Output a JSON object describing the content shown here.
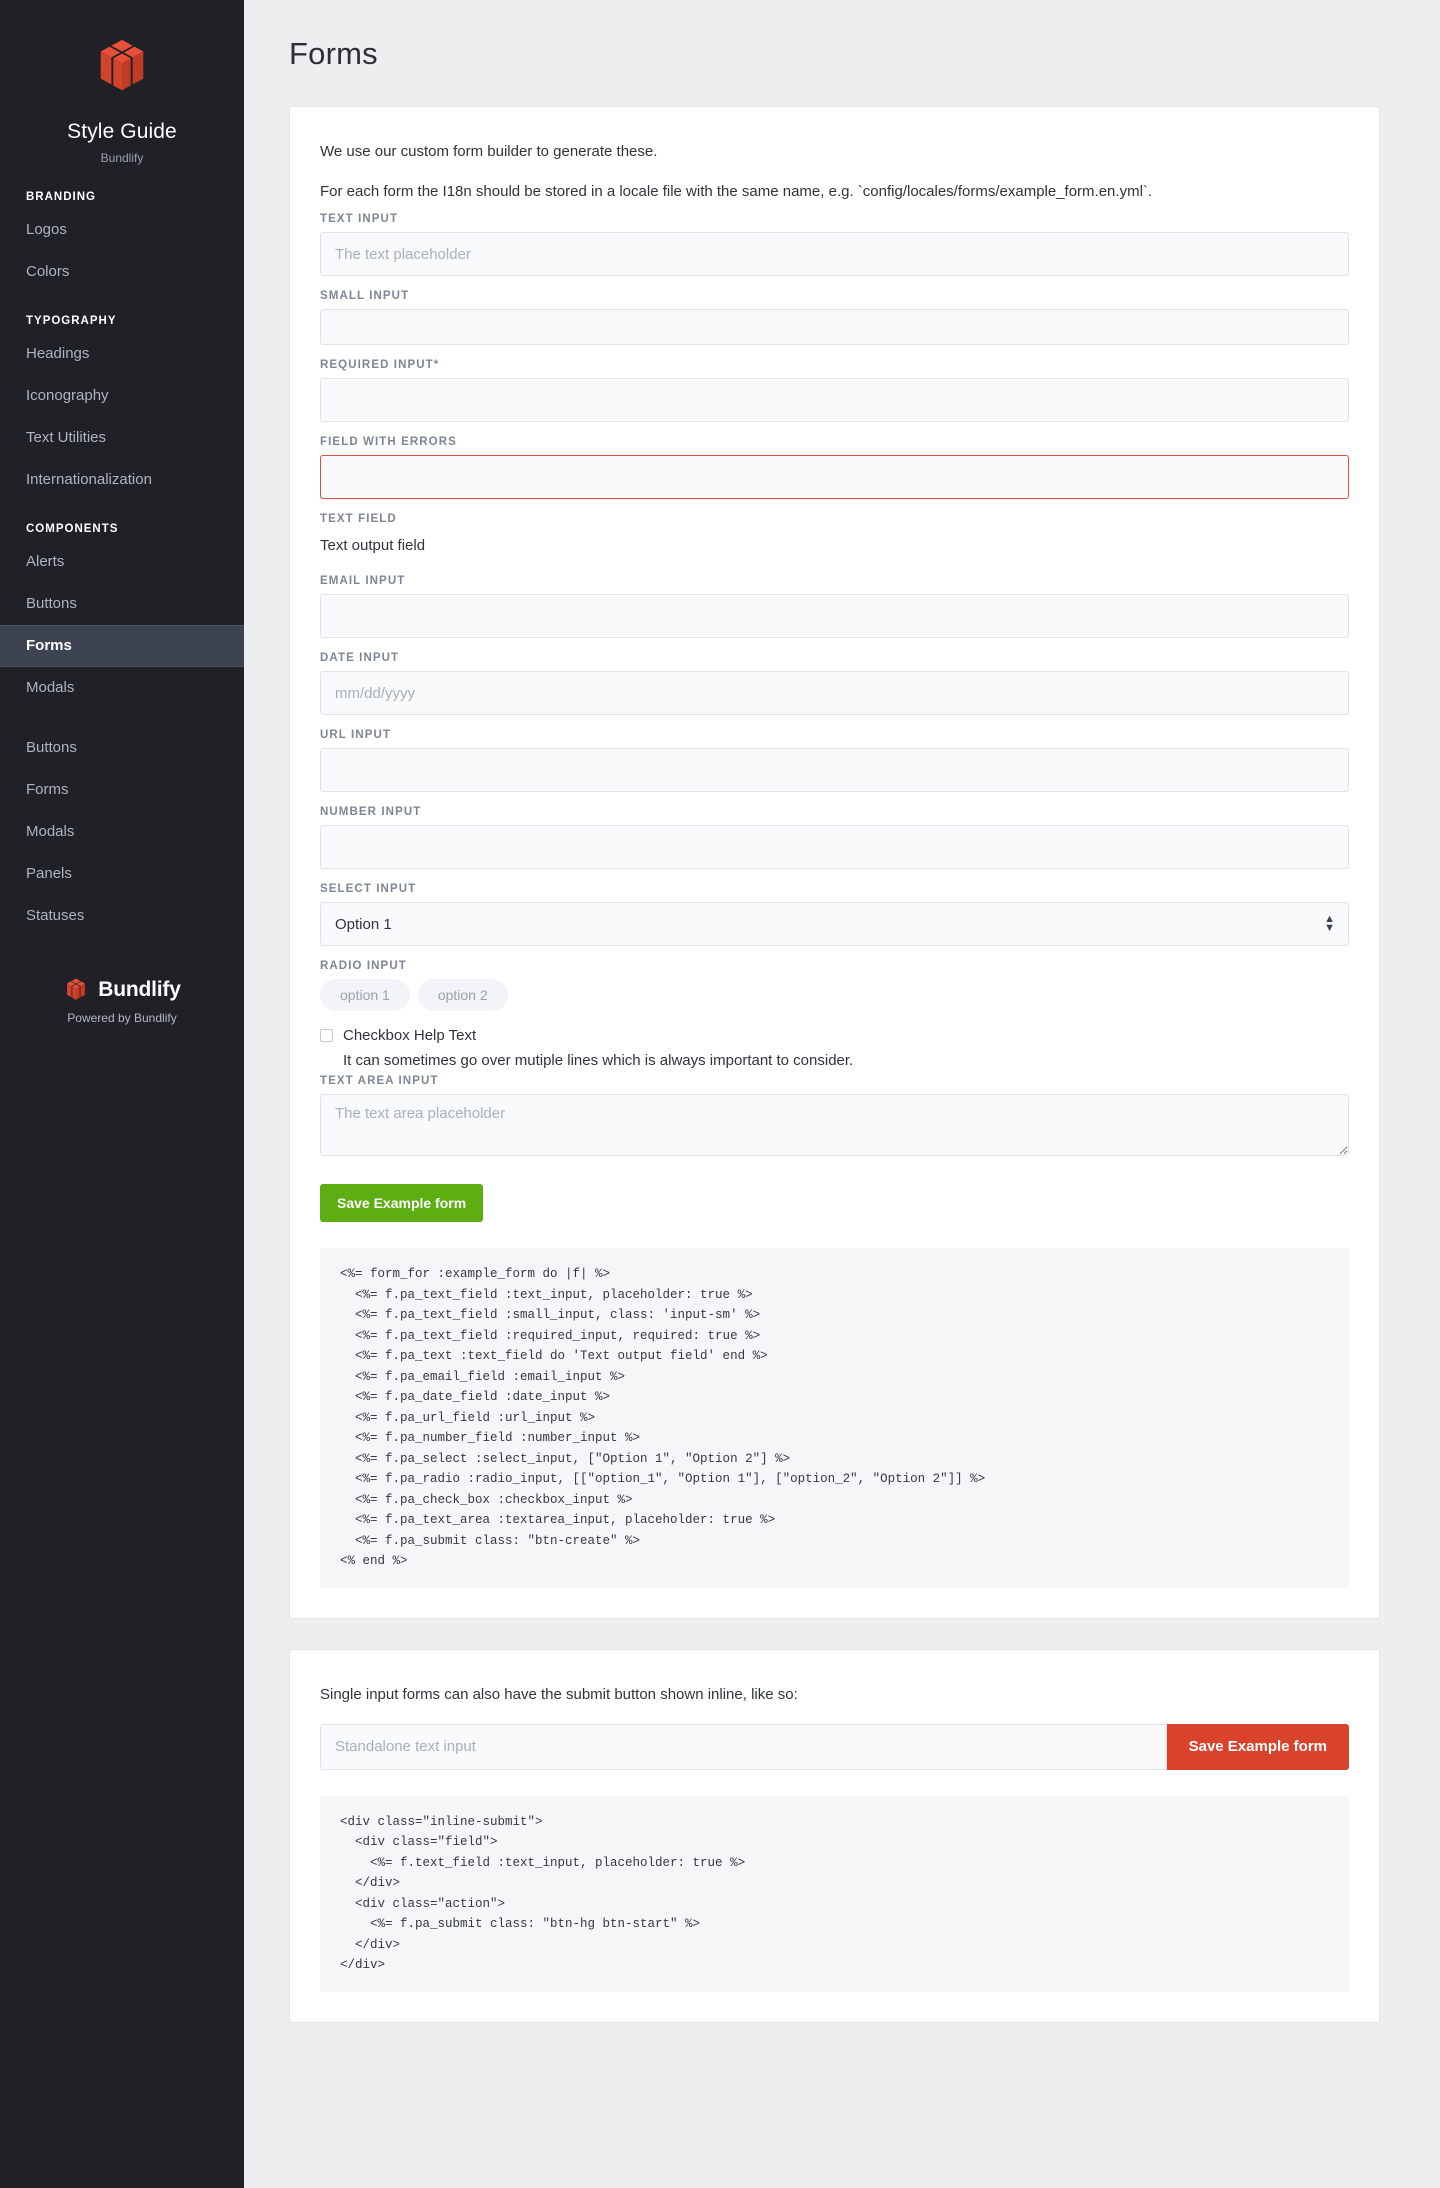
{
  "sidebar": {
    "brand": {
      "logo_icon": "cube-logo-icon",
      "title": "Style Guide",
      "subtitle": "Bundlify"
    },
    "groups": [
      {
        "section": "BRANDING",
        "items": [
          {
            "label": "Logos",
            "active": false
          },
          {
            "label": "Colors",
            "active": false
          }
        ]
      },
      {
        "section": "TYPOGRAPHY",
        "items": [
          {
            "label": "Headings",
            "active": false
          },
          {
            "label": "Iconography",
            "active": false
          },
          {
            "label": "Text Utilities",
            "active": false
          },
          {
            "label": "Internationalization",
            "active": false
          }
        ]
      },
      {
        "section": "COMPONENTS",
        "items": [
          {
            "label": "Alerts",
            "active": false
          },
          {
            "label": "Buttons",
            "active": false
          },
          {
            "label": "Forms",
            "active": true
          },
          {
            "label": "Modals",
            "active": false
          }
        ]
      },
      {
        "section": "",
        "items": [
          {
            "label": "Buttons",
            "active": false
          },
          {
            "label": "Forms",
            "active": false
          },
          {
            "label": "Modals",
            "active": false
          },
          {
            "label": "Panels",
            "active": false
          },
          {
            "label": "Statuses",
            "active": false
          }
        ]
      }
    ],
    "footer": {
      "logo_icon": "cube-logo-icon",
      "name": "Bundlify",
      "powered_by": "Powered by Bundlify"
    }
  },
  "page": {
    "title": "Forms"
  },
  "card1": {
    "lead1": "We use our custom form builder to generate these.",
    "lead2": "For each form the I18n should be stored in a locale file with the same name, e.g. `config/locales/forms/example_form.en.yml`.",
    "fields": {
      "text_input": {
        "label": "TEXT INPUT",
        "placeholder": "The text placeholder",
        "value": ""
      },
      "small_input": {
        "label": "SMALL INPUT",
        "placeholder": "",
        "value": ""
      },
      "required_input": {
        "label": "REQUIRED INPUT*",
        "placeholder": "",
        "value": ""
      },
      "field_with_errors": {
        "label": "FIELD WITH ERRORS",
        "placeholder": "",
        "value": ""
      },
      "text_field": {
        "label": "TEXT FIELD",
        "value": "Text output field"
      },
      "email_input": {
        "label": "EMAIL INPUT",
        "placeholder": "",
        "value": ""
      },
      "date_input": {
        "label": "DATE INPUT",
        "placeholder": "mm/dd/yyyy",
        "value": ""
      },
      "url_input": {
        "label": "URL INPUT",
        "placeholder": "",
        "value": ""
      },
      "number_input": {
        "label": "NUMBER INPUT",
        "placeholder": "",
        "value": ""
      },
      "select_input": {
        "label": "SELECT INPUT",
        "selected": "Option 1",
        "options": [
          "Option 1",
          "Option 2"
        ],
        "arrow_icon": "select-stepper-icon"
      },
      "radio_input": {
        "label": "RADIO INPUT",
        "options": [
          "option 1",
          "option 2"
        ]
      },
      "checkbox_input": {
        "label": "Checkbox Help Text",
        "help": "It can sometimes go over mutiple lines which is always important to consider.",
        "checked": false
      },
      "textarea_input": {
        "label": "TEXT AREA INPUT",
        "placeholder": "The text area placeholder",
        "value": ""
      }
    },
    "submit_label": "Save Example form",
    "code": "<%= form_for :example_form do |f| %>\n  <%= f.pa_text_field :text_input, placeholder: true %>\n  <%= f.pa_text_field :small_input, class: 'input-sm' %>\n  <%= f.pa_text_field :required_input, required: true %>\n  <%= f.pa_text :text_field do 'Text output field' end %>\n  <%= f.pa_email_field :email_input %>\n  <%= f.pa_date_field :date_input %>\n  <%= f.pa_url_field :url_input %>\n  <%= f.pa_number_field :number_input %>\n  <%= f.pa_select :select_input, [\"Option 1\", \"Option 2\"] %>\n  <%= f.pa_radio :radio_input, [[\"option_1\", \"Option 1\"], [\"option_2\", \"Option 2\"]] %>\n  <%= f.pa_check_box :checkbox_input %>\n  <%= f.pa_text_area :textarea_input, placeholder: true %>\n  <%= f.pa_submit class: \"btn-create\" %>\n<% end %>"
  },
  "card2": {
    "lead": "Single input forms can also have the submit button shown inline, like so:",
    "standalone_input": {
      "placeholder": "Standalone text input",
      "value": ""
    },
    "submit_label": "Save Example form",
    "code": "<div class=\"inline-submit\">\n  <div class=\"field\">\n    <%= f.text_field :text_input, placeholder: true %>\n  </div>\n  <div class=\"action\">\n    <%= f.pa_submit class: \"btn-hg btn-start\" %>\n  </div>\n</div>"
  },
  "colors": {
    "sidebar_bg": "#1f2127",
    "sidebar_active": "#3e4351",
    "brand_red": "#d9432c",
    "submit_green": "#5cae13",
    "error_red": "#d9503f",
    "page_bg": "#eceef0"
  }
}
